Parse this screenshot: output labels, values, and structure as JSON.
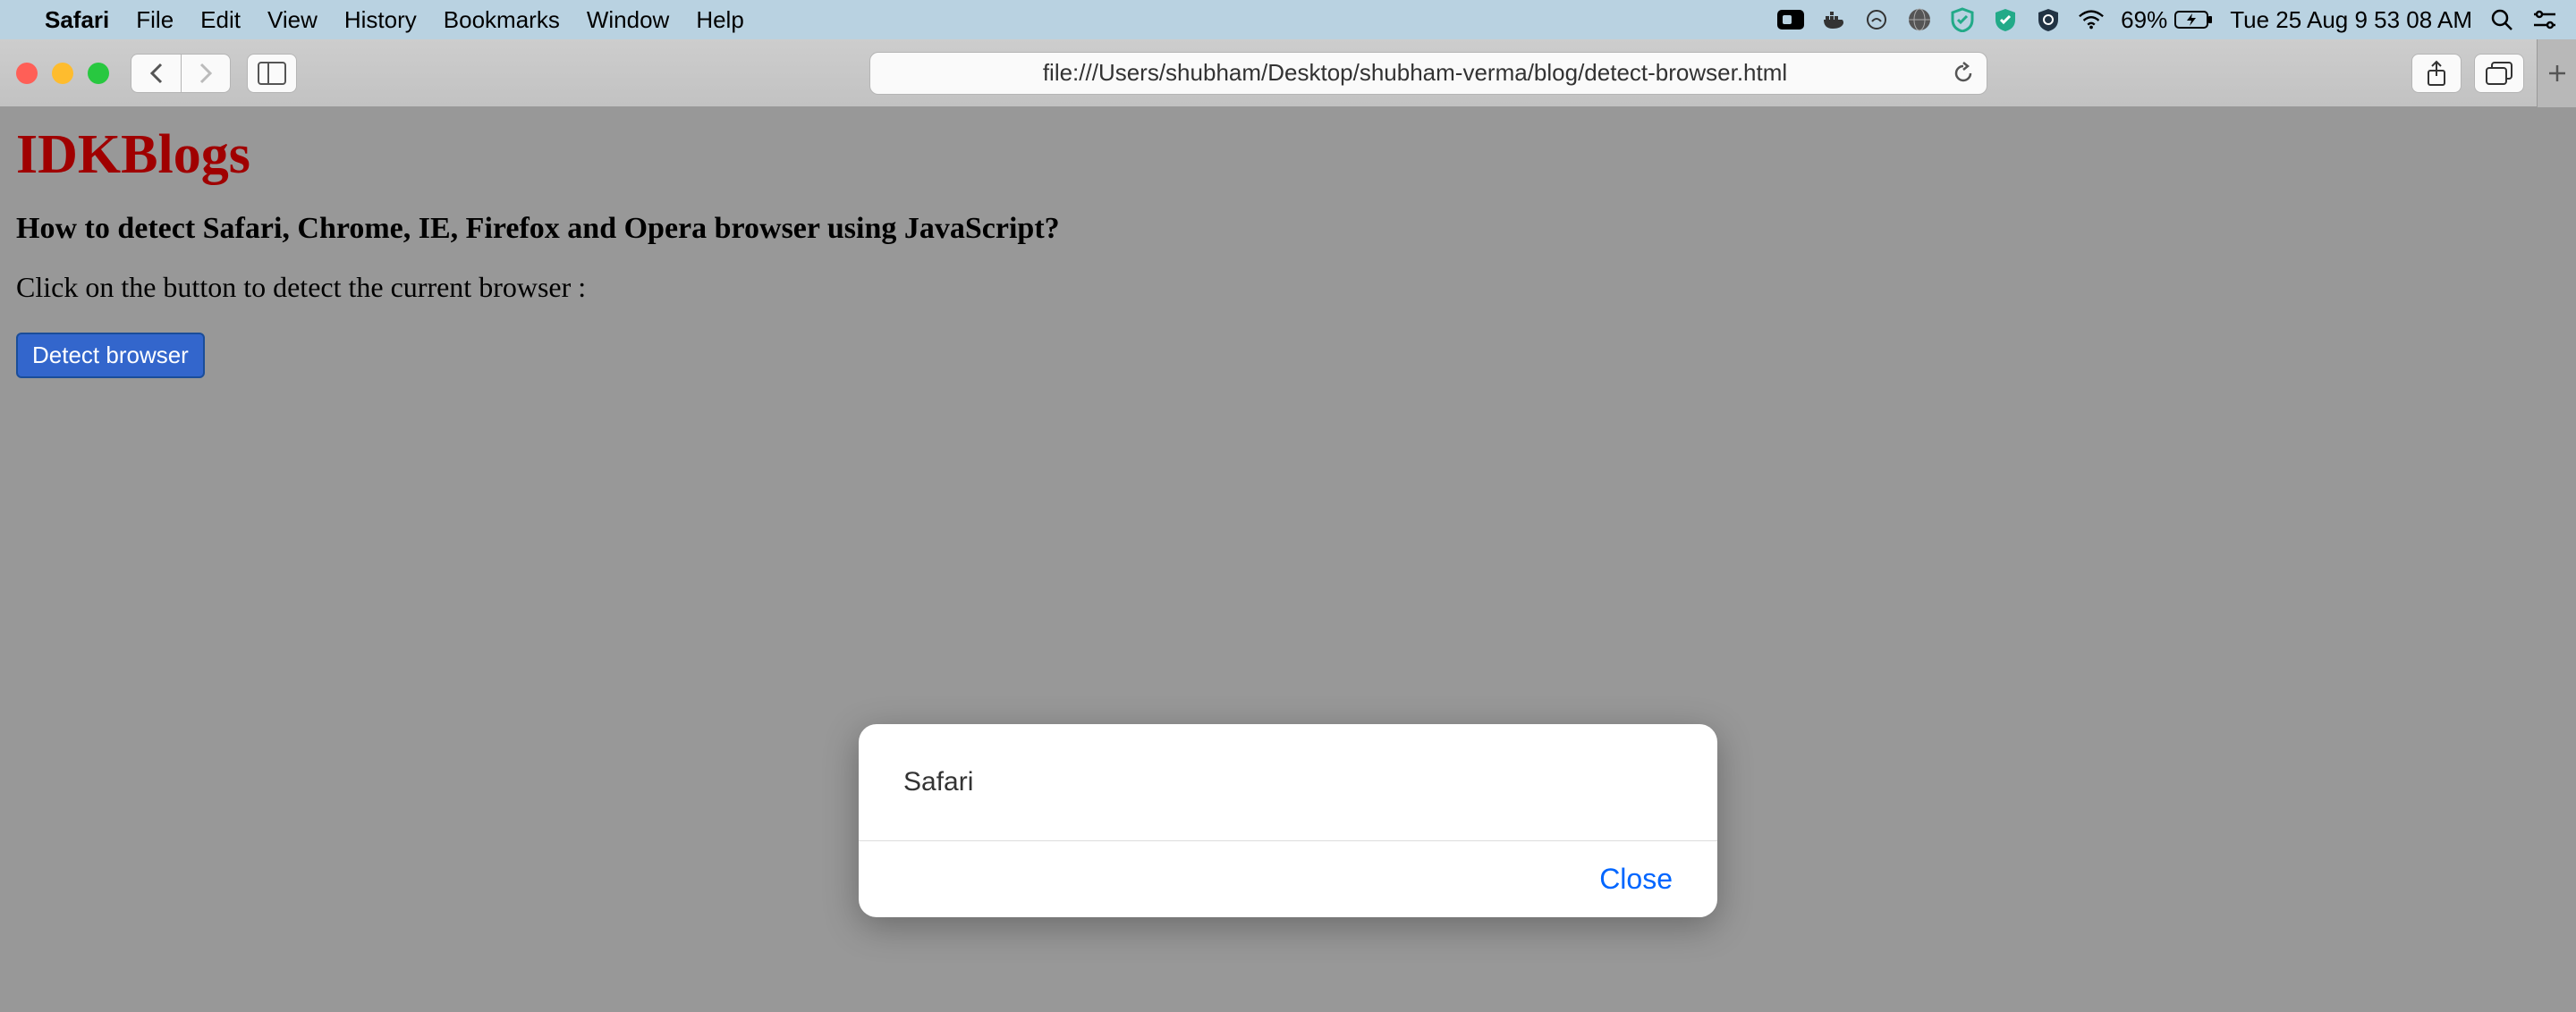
{
  "menubar": {
    "app_name": "Safari",
    "items": [
      "File",
      "Edit",
      "View",
      "History",
      "Bookmarks",
      "Window",
      "Help"
    ],
    "battery_percent": "69%",
    "datetime": "Tue 25 Aug  9 53 08 AM"
  },
  "toolbar": {
    "url": "file:///Users/shubham/Desktop/shubham-verma/blog/detect-browser.html"
  },
  "page": {
    "title": "IDKBlogs",
    "subtitle": "How to detect Safari, Chrome, IE, Firefox and Opera browser using JavaScript?",
    "instruction": "Click on the button to detect the current browser :",
    "button_label": "Detect browser"
  },
  "alert": {
    "message": "Safari",
    "close_label": "Close"
  }
}
